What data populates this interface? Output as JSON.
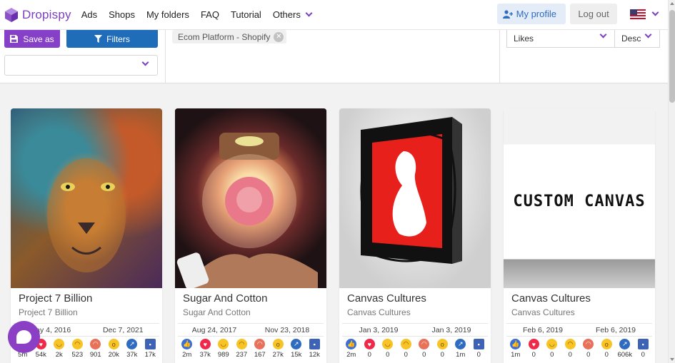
{
  "brand": {
    "name": "Dropispy",
    "accent": "#7b3fbf"
  },
  "nav": {
    "links": [
      "Ads",
      "Shops",
      "My folders",
      "FAQ",
      "Tutorial"
    ],
    "others_label": "Others",
    "profile_label": "My profile",
    "logout_label": "Log out",
    "language_flag": "us-flag-icon"
  },
  "toolbar": {
    "save_label": "Save as",
    "filters_label": "Filters",
    "folder_select_value": "",
    "active_tag": "Ecom Platform - Shopify",
    "sort_by": "Likes",
    "sort_order": "Desc"
  },
  "colors": {
    "save": "#8640c8",
    "filters": "#1f6db8",
    "chat": "#8a3fc4"
  },
  "cards": [
    {
      "title": "Project 7 Billion",
      "shop": "Project 7 Billion",
      "date_start": "May 4, 2016",
      "date_end": "Dec 7, 2021",
      "counts": {
        "like": "5m",
        "love": "54k",
        "haha": "2k",
        "sad": "523",
        "angry": "901",
        "wow": "20k",
        "share": "37k",
        "comment": "17k"
      },
      "image": "lion-painting"
    },
    {
      "title": "Sugar And Cotton",
      "shop": "Sugar And Cotton",
      "date_start": "Aug 24, 2017",
      "date_end": "Nov 23, 2018",
      "counts": {
        "like": "2m",
        "love": "37k",
        "haha": "989",
        "sad": "237",
        "angry": "167",
        "wow": "27k",
        "share": "15k",
        "comment": "12k"
      },
      "image": "rose-glass-jar-light"
    },
    {
      "title": "Canvas Cultures",
      "shop": "Canvas Cultures",
      "date_start": "Jan 3, 2019",
      "date_end": "Jan 3, 2019",
      "counts": {
        "like": "2m",
        "love": "0",
        "haha": "0",
        "sad": "0",
        "angry": "0",
        "wow": "0",
        "share": "1m",
        "comment": "0"
      },
      "image": "red-canvas-figure"
    },
    {
      "title": "Canvas Cultures",
      "shop": "Canvas Cultures",
      "date_start": "Feb 6, 2019",
      "date_end": "Feb 6, 2019",
      "counts": {
        "like": "1m",
        "love": "0",
        "haha": "0",
        "sad": "0",
        "angry": "0",
        "wow": "0",
        "share": "606k",
        "comment": "0"
      },
      "image": "custom-canvas-sign",
      "image_text": "CUSTOM CANVAS"
    }
  ]
}
